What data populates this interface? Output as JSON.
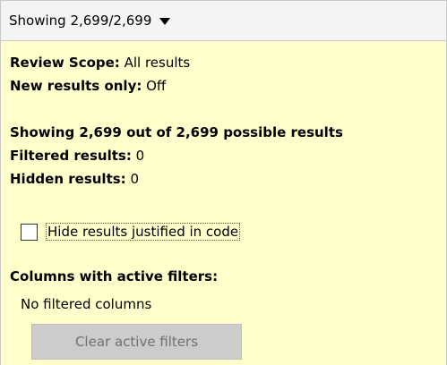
{
  "dropdown": {
    "label": "Showing 2,699/2,699"
  },
  "scope": {
    "review_scope_label": "Review Scope:",
    "review_scope_value": " All results",
    "new_results_label": "New results only:",
    "new_results_value": " Off"
  },
  "summary": {
    "showing_text": "Showing 2,699 out of 2,699 possible results",
    "filtered_label": "Filtered results:",
    "filtered_value": " 0",
    "hidden_label": "Hidden results:",
    "hidden_value": " 0"
  },
  "options": {
    "hide_justified_label": "Hide results justified in code",
    "hide_justified_checked": false
  },
  "filters": {
    "heading": "Columns with active filters:",
    "none_text": "No filtered columns",
    "clear_button_label": "Clear active filters",
    "clear_button_enabled": false
  },
  "colors": {
    "panel_background": "#ffffcc",
    "disabled_button_background": "#cccccc",
    "disabled_text": "#707070"
  }
}
